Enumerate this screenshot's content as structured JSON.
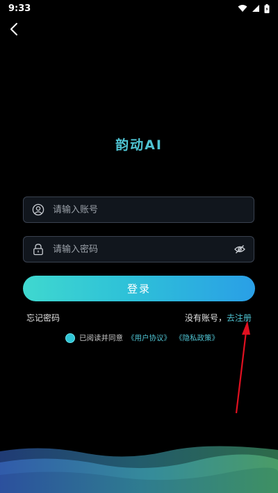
{
  "status_bar": {
    "time": "9:33"
  },
  "header": {
    "back_icon": "chevron-left-icon"
  },
  "app": {
    "title": "韵动AI"
  },
  "form": {
    "account_placeholder": "请输入账号",
    "account_value": "",
    "password_placeholder": "请输入密码",
    "password_value": "",
    "login_label": "登录"
  },
  "links": {
    "forgot_password": "忘记密码",
    "no_account_text": "没有账号，",
    "register_link": "去注册"
  },
  "agreement": {
    "prefix": "已阅读并同意",
    "user_agreement": "《用户协议》",
    "privacy_policy": "《隐私政策》",
    "checked": true
  },
  "colors": {
    "accent": "#4fc3d2",
    "button_gradient_start": "#3fd8cf",
    "button_gradient_end": "#2a9fe6",
    "annotation_arrow": "#e01020"
  }
}
